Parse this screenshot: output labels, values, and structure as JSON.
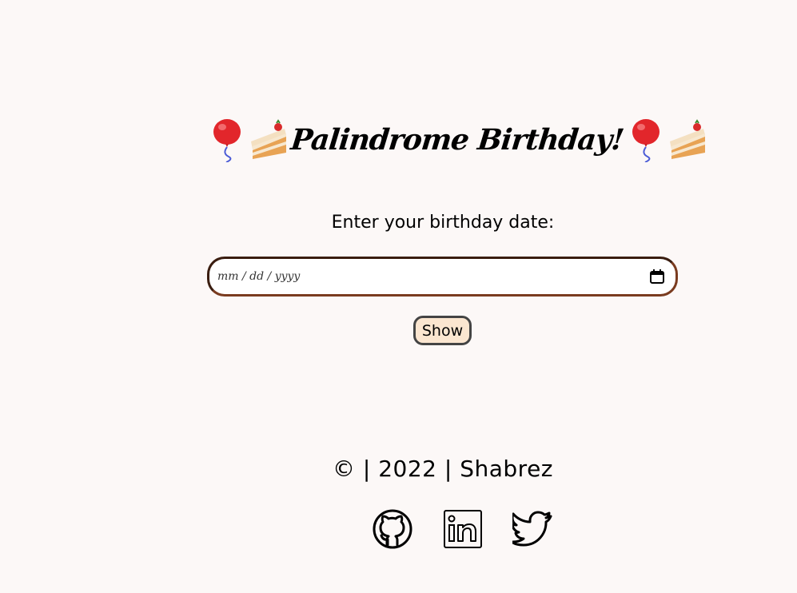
{
  "header": {
    "title": "Palindrome Birthday!",
    "emojis": [
      "balloon-icon",
      "cake-icon",
      "balloon-icon",
      "cake-icon"
    ]
  },
  "form": {
    "prompt": "Enter your birthday date:",
    "date_placeholder": "mm / dd / yyyy",
    "show_label": "Show"
  },
  "footer": {
    "text": "© | 2022 | Shabrez",
    "socials": [
      "github-icon",
      "linkedin-icon",
      "twitter-icon"
    ]
  }
}
